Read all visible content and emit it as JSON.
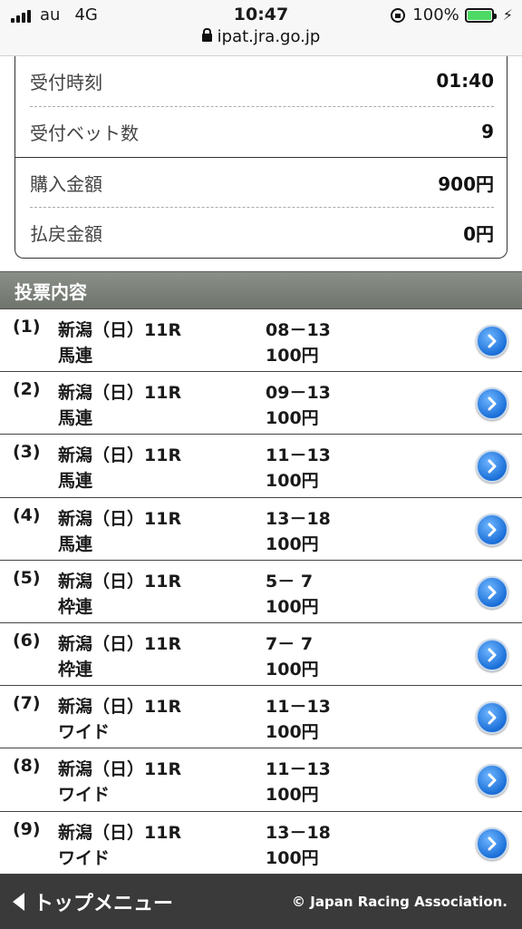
{
  "status_bar": {
    "carrier": "au",
    "network": "4G",
    "time": "10:47",
    "battery_percent": "100%",
    "url": "ipat.jra.go.jp",
    "icons": [
      "signal-icon",
      "rotation-lock-icon",
      "battery-icon",
      "charging-icon",
      "lock-icon"
    ]
  },
  "summary": {
    "rows": [
      {
        "label": "受付時刻",
        "value": "01:40"
      },
      {
        "label": "受付ベット数",
        "value": "9"
      },
      {
        "label": "購入金額",
        "value": "900円"
      },
      {
        "label": "払戻金額",
        "value": "0円"
      }
    ]
  },
  "section": {
    "title": "投票内容"
  },
  "bets": [
    {
      "num": "(1)",
      "race": "新潟（日）11R",
      "type": "馬連",
      "combo": "08－13",
      "amount": "100円"
    },
    {
      "num": "(2)",
      "race": "新潟（日）11R",
      "type": "馬連",
      "combo": "09－13",
      "amount": "100円"
    },
    {
      "num": "(3)",
      "race": "新潟（日）11R",
      "type": "馬連",
      "combo": "11－13",
      "amount": "100円"
    },
    {
      "num": "(4)",
      "race": "新潟（日）11R",
      "type": "馬連",
      "combo": "13－18",
      "amount": "100円"
    },
    {
      "num": "(5)",
      "race": "新潟（日）11R",
      "type": "枠連",
      "combo": "5－ 7",
      "amount": "100円"
    },
    {
      "num": "(6)",
      "race": "新潟（日）11R",
      "type": "枠連",
      "combo": "7－ 7",
      "amount": "100円"
    },
    {
      "num": "(7)",
      "race": "新潟（日）11R",
      "type": "ワイド",
      "combo": "11－13",
      "amount": "100円"
    },
    {
      "num": "(8)",
      "race": "新潟（日）11R",
      "type": "ワイド",
      "combo": "11－13",
      "amount": "100円"
    },
    {
      "num": "(9)",
      "race": "新潟（日）11R",
      "type": "ワイド",
      "combo": "13－18",
      "amount": "100円"
    }
  ],
  "footer": {
    "menu_label": "トップメニュー",
    "copyright": "© Japan Racing Association."
  },
  "colors": {
    "section_header": "#777d75",
    "footer": "#3a3a3a",
    "button_blue": "#1a6fd8",
    "battery_green": "#4cd964"
  }
}
